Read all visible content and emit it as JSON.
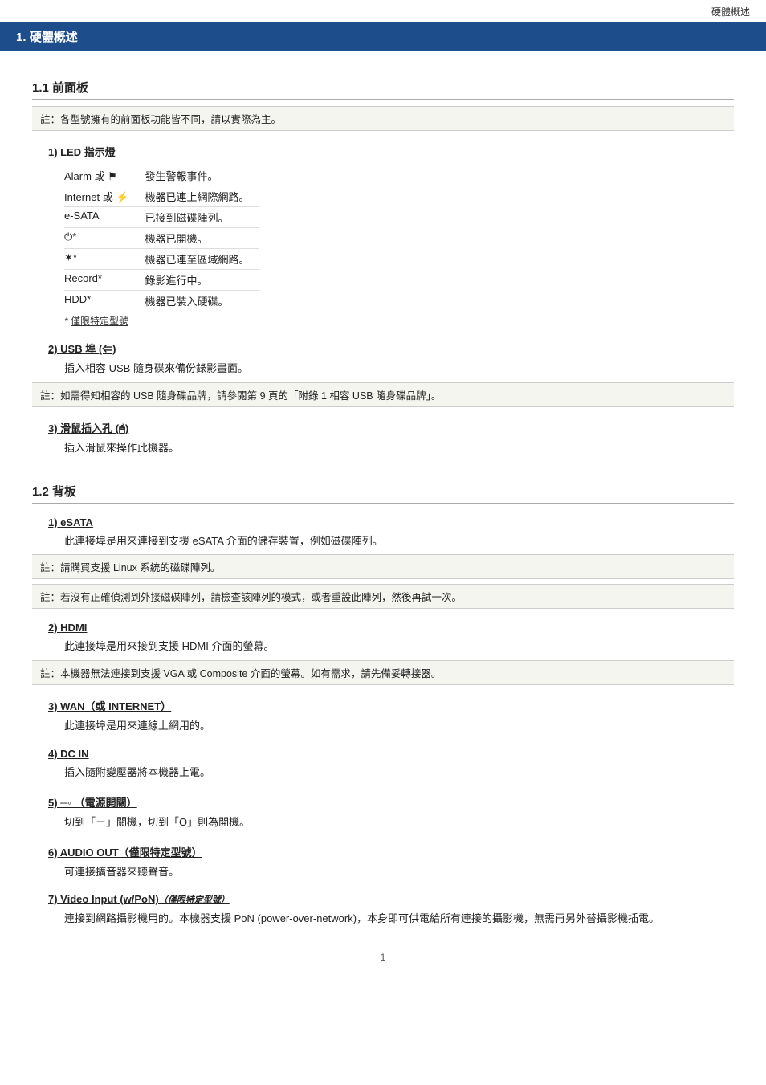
{
  "topbar": {
    "label": "硬體概述"
  },
  "header": {
    "number": "1.",
    "title": "硬體概述"
  },
  "section1": {
    "number": "1.1",
    "title": "前面板",
    "note": "註：各型號擁有的前面板功能皆不同，請以實際為主。",
    "items": [
      {
        "number": "1)",
        "title": "LED 指示燈",
        "type": "table",
        "rows": [
          {
            "label": "Alarm 或 ⚑",
            "desc": "發生警報事件。"
          },
          {
            "label": "Internet 或 ⚡",
            "desc": "機器已連上網際網路。"
          },
          {
            "label": "e-SATA",
            "desc": "已接到磁碟陣列。"
          },
          {
            "label": "⏻*",
            "desc": "機器已開機。"
          },
          {
            "label": "☆*",
            "desc": "機器已連至區域網路。"
          },
          {
            "label": "Record*",
            "desc": "錄影進行中。"
          },
          {
            "label": "HDD*",
            "desc": "機器已裝入硬碟。"
          }
        ],
        "footnote": "* 僅限特定型號"
      },
      {
        "number": "2)",
        "title": "USB 埠 (⇐)",
        "desc": "插入相容 USB 隨身碟來備份錄影畫面。"
      },
      {
        "number": "3)",
        "title": "滑鼠插入孔 (🖱)",
        "desc": "插入滑鼠來操作此機器。"
      }
    ],
    "note2": "註：如需得知相容的 USB 隨身碟品牌，請參閱第 9 頁的「附錄 1  相容 USB 隨身碟品牌」。"
  },
  "section2": {
    "number": "1.2",
    "title": "背板",
    "items": [
      {
        "number": "1)",
        "title": "eSATA",
        "desc": "此連接埠是用來連接到支援 eSATA 介面的儲存裝置，例如磁碟陣列。",
        "note": "註：請購買支援 Linux 系統的磁碟陣列。",
        "note2": "註：若沒有正確偵測到外接磁碟陣列，請檢查該陣列的模式，或者重設此陣列，然後再試一次。"
      },
      {
        "number": "2)",
        "title": "HDMI",
        "desc": "此連接埠是用來接到支援 HDMI 介面的螢幕。",
        "note": "註：本機器無法連接到支援 VGA 或 Composite 介面的螢幕。如有需求，請先備妥轉接器。"
      },
      {
        "number": "3)",
        "title": "WAN（或 INTERNET）",
        "desc": "此連接埠是用來連線上網用的。"
      },
      {
        "number": "4)",
        "title": "DC IN",
        "desc": "插入隨附變壓器將本機器上電。"
      },
      {
        "number": "5)",
        "title": "⊶ （電源開關）",
        "desc": "切到「－」關機，切到「О」則為開機。"
      },
      {
        "number": "6)",
        "title": "AUDIO OUT（僅限特定型號）",
        "desc": "可連接擴音器來聽聲音。"
      },
      {
        "number": "7)",
        "title": "Video Input (w/PoN)",
        "title_suffix": "（僅限特定型號）",
        "desc": "連接到網路攝影機用的。本機器支援 PoN (power-over-network)，本身即可供電給所有連接的攝影機，無需再另外替攝影機插電。"
      }
    ]
  },
  "page_number": "1"
}
